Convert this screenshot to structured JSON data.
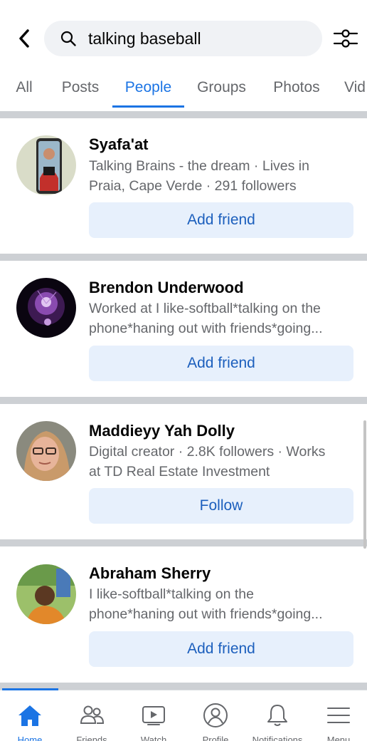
{
  "search": {
    "query": "talking baseball",
    "back_icon": "chevron-left-icon",
    "search_icon": "search-icon",
    "filter_icon": "filter-sliders-icon"
  },
  "tabs": [
    {
      "label": "All"
    },
    {
      "label": "Posts"
    },
    {
      "label": "People",
      "active": true
    },
    {
      "label": "Groups"
    },
    {
      "label": "Photos"
    },
    {
      "label": "Vid"
    }
  ],
  "results": [
    {
      "name": "Syafa'at",
      "meta_lines": [
        "Talking Brains - the dream · Lives in",
        "Praia, Cape Verde · 291 followers"
      ],
      "action": "Add friend"
    },
    {
      "name": "Brendon Underwood",
      "meta_lines": [
        "Worked at I like-softball*talking on the",
        "phone*haning out with friends*going..."
      ],
      "action": "Add friend"
    },
    {
      "name": "Maddieyy Yah Dolly",
      "meta_lines": [
        "Digital creator · 2.8K followers · Works",
        "at TD Real Estate Investment"
      ],
      "action": "Follow"
    },
    {
      "name": "Abraham Sherry",
      "meta_lines": [
        "I like-softball*talking on the",
        "phone*haning out with friends*going..."
      ],
      "action": "Add friend"
    }
  ],
  "bottom_nav": [
    {
      "label": "Home",
      "icon": "home-icon",
      "active": true
    },
    {
      "label": "Friends",
      "icon": "friends-icon"
    },
    {
      "label": "Watch",
      "icon": "watch-icon"
    },
    {
      "label": "Profile",
      "icon": "profile-icon"
    },
    {
      "label": "Notifications",
      "icon": "bell-icon"
    },
    {
      "label": "Menu",
      "icon": "menu-icon"
    }
  ],
  "colors": {
    "accent": "#1b74e4",
    "button_bg": "#e7f0fc",
    "button_text": "#1c5fbd",
    "secondary_text": "#65676b",
    "divider": "#cdd0d4"
  }
}
